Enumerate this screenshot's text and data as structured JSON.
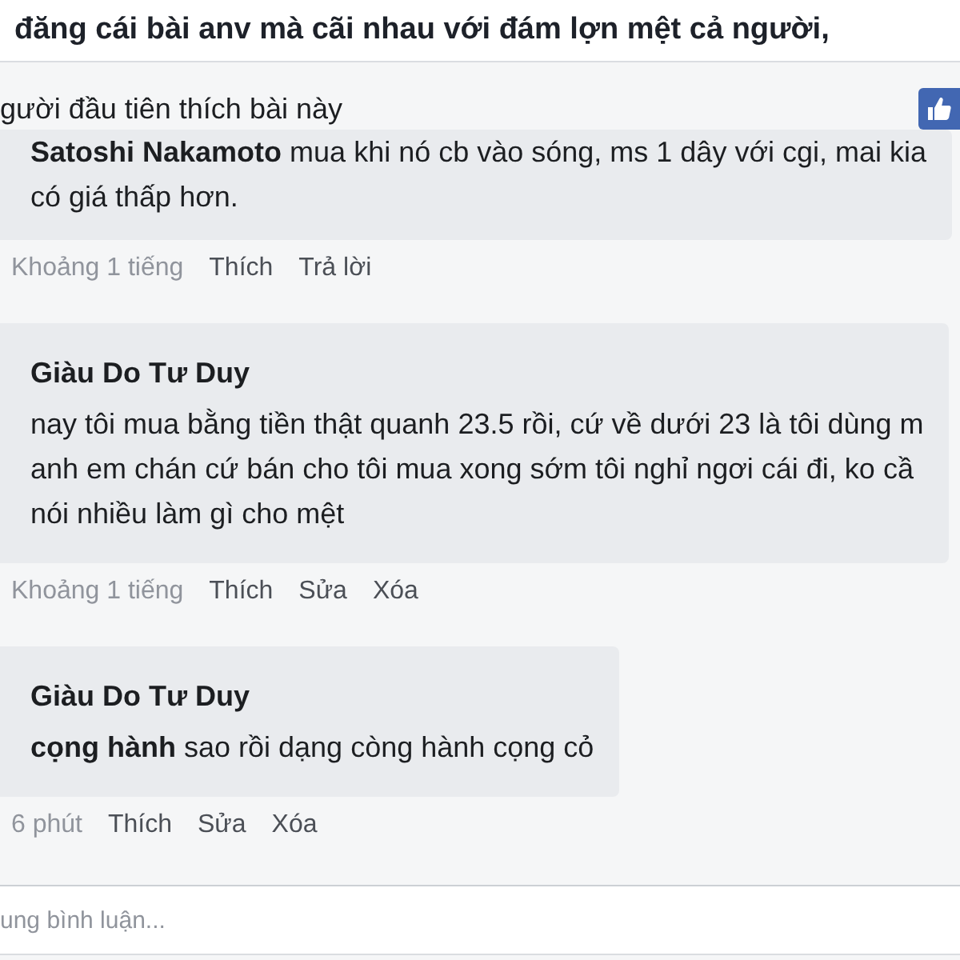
{
  "post": {
    "title": "đăng cái bài anv mà cãi nhau với đám lợn mệt cả người,"
  },
  "likes": {
    "text": "gười đầu tiên thích bài này"
  },
  "comments": [
    {
      "kind": "inline",
      "text": "**Satoshi Nakamoto** mua khi nó cb vào sóng, ms 1 dây với cgi, mai kia\ncó giá thấp hơn.",
      "time": "Khoảng 1 tiếng",
      "actions": [
        "Thích",
        "Trả lời"
      ]
    },
    {
      "kind": "block",
      "author": "Giàu Do Tư Duy",
      "text": "nay tôi mua bằng tiền thật quanh 23.5 rồi, cứ về dưới 23 là tôi dùng m\nanh em chán cứ bán cho tôi mua xong sớm tôi nghỉ ngơi cái đi, ko cầ\nnói nhiều làm gì cho mệt",
      "time": "Khoảng 1 tiếng",
      "actions": [
        "Thích",
        "Sửa",
        "Xóa"
      ]
    },
    {
      "kind": "block",
      "author": "Giàu Do Tư Duy",
      "text": "**cọng hành** sao rồi dạng còng hành cọng cỏ",
      "time": "6 phút",
      "actions": [
        "Thích",
        "Sửa",
        "Xóa"
      ]
    }
  ],
  "composer": {
    "placeholder": "ung bình luận..."
  }
}
